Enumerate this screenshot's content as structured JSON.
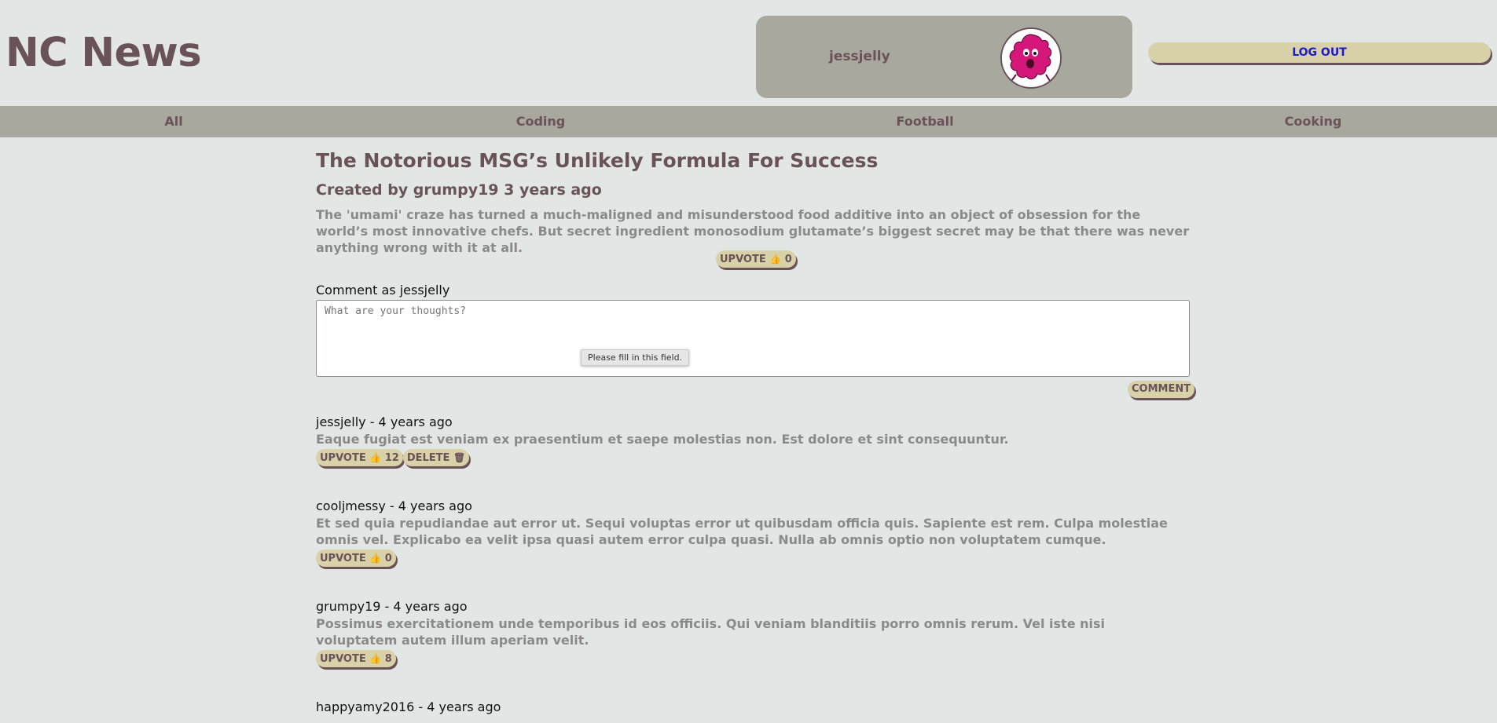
{
  "site": {
    "title": "NC News"
  },
  "user": {
    "username": "jessjelly",
    "logout_label": "LOG OUT"
  },
  "nav": {
    "topics": [
      "All",
      "Coding",
      "Football",
      "Cooking"
    ]
  },
  "article": {
    "title": "The Notorious MSG’s Unlikely Formula For Success",
    "meta": "Created by grumpy19 3 years ago",
    "body": "The 'umami' craze has turned a much-maligned and misunderstood food additive into an object of obsession for the world’s most innovative chefs. But secret ingredient monosodium glutamate’s biggest secret may be that there was never anything wrong with it at all.",
    "upvote_label": "UPVOTE",
    "votes": "0"
  },
  "comment_form": {
    "label": "Comment as jessjelly",
    "placeholder": "What are your thoughts?",
    "validation_tooltip": "Please fill in this field.",
    "submit_label": "COMMENT"
  },
  "comments": [
    {
      "header": "jessjelly - 4 years ago",
      "body": "Eaque fugiat est veniam ex praesentium et saepe molestias non. Est dolore et sint consequuntur.",
      "upvote_label": "UPVOTE",
      "votes": "12",
      "delete_label": "DELETE"
    },
    {
      "header": "cooljmessy - 4 years ago",
      "body": "Et sed quia repudiandae aut error ut. Sequi voluptas error ut quibusdam officia quis. Sapiente est rem. Culpa molestiae omnis vel. Explicabo ea velit ipsa quasi autem error culpa quasi. Nulla ab omnis optio non voluptatem cumque.",
      "upvote_label": "UPVOTE",
      "votes": "0"
    },
    {
      "header": "grumpy19 - 4 years ago",
      "body": "Possimus exercitationem unde temporibus id eos officiis. Qui veniam blanditiis porro omnis rerum. Vel iste nisi voluptatem autem illum aperiam velit.",
      "upvote_label": "UPVOTE",
      "votes": "8"
    },
    {
      "header": "happyamy2016 - 4 years ago"
    }
  ],
  "icons": {
    "thumbs_up": "thumbs-up-icon",
    "trash": "trash-icon",
    "avatar": "mr-men-avatar"
  },
  "colors": {
    "background": "#e2e6e5",
    "bar": "#a8a89f",
    "button": "#d9d1a8",
    "text": "#6a5358",
    "muted": "#8a8a8a",
    "link": "#1a1ad0",
    "avatar_pink": "#d6177a"
  }
}
